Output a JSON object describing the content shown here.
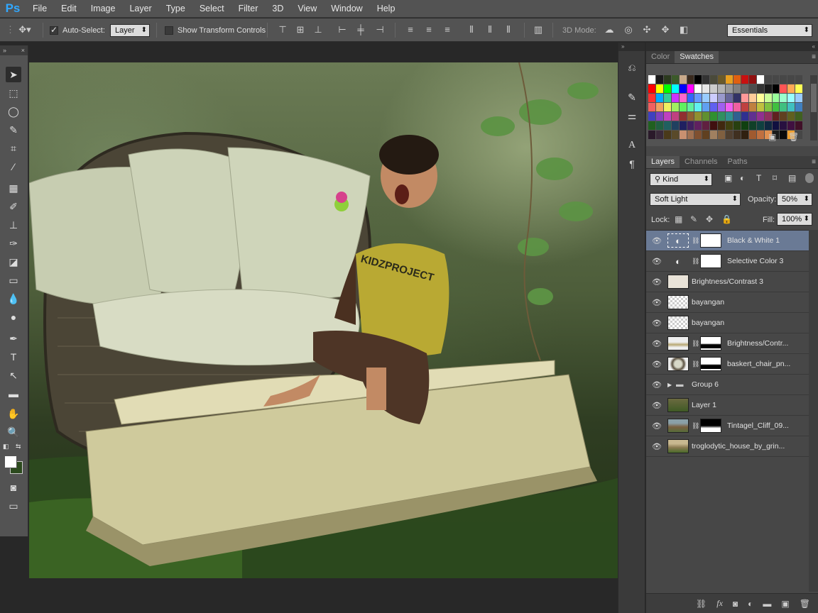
{
  "app": {
    "logo": "Ps"
  },
  "menu": [
    "File",
    "Edit",
    "Image",
    "Layer",
    "Type",
    "Select",
    "Filter",
    "3D",
    "View",
    "Window",
    "Help"
  ],
  "options": {
    "auto_select_label": "Auto-Select:",
    "auto_select_value": "Layer",
    "show_transform_label": "Show Transform Controls",
    "mode_3d_label": "3D Mode:",
    "workspace": "Essentials"
  },
  "swatch_panel": {
    "tabs": [
      "Color",
      "Swatches"
    ],
    "active_tab": "Swatches"
  },
  "layers_panel": {
    "tabs": [
      "Layers",
      "Channels",
      "Paths"
    ],
    "active_tab": "Layers",
    "kind_filter": "Kind",
    "blend_mode": "Soft Light",
    "opacity_label": "Opacity:",
    "opacity": "50%",
    "lock_label": "Lock:",
    "fill_label": "Fill:",
    "fill": "100%",
    "layers": [
      {
        "name": "Black & White 1",
        "type": "adjustment-bw",
        "mask": true,
        "selected": true
      },
      {
        "name": "Selective Color 3",
        "type": "adjustment-selective",
        "mask": true,
        "selected": false
      },
      {
        "name": "Brightness/Contrast 3",
        "type": "image-boy",
        "mask": false,
        "selected": false
      },
      {
        "name": "bayangan",
        "type": "checker",
        "mask": false,
        "selected": false
      },
      {
        "name": "bayangan",
        "type": "checker",
        "mask": false,
        "selected": false
      },
      {
        "name": "Brightness/Contr...",
        "type": "image-book",
        "mask": true,
        "selected": false
      },
      {
        "name": "baskert_chair_pn...",
        "type": "image-chair",
        "mask": true,
        "selected": false
      },
      {
        "name": "Group 6",
        "type": "group",
        "mask": false,
        "selected": false
      },
      {
        "name": "Layer 1",
        "type": "image-grass",
        "mask": false,
        "selected": false
      },
      {
        "name": "Tintagel_Cliff_09...",
        "type": "image-cliff",
        "mask": true,
        "selected": false
      },
      {
        "name": "troglodytic_house_by_grin...",
        "type": "image-house",
        "mask": false,
        "selected": false
      }
    ]
  },
  "canvas": {
    "shirt_text": "KIDZPROJECT"
  }
}
